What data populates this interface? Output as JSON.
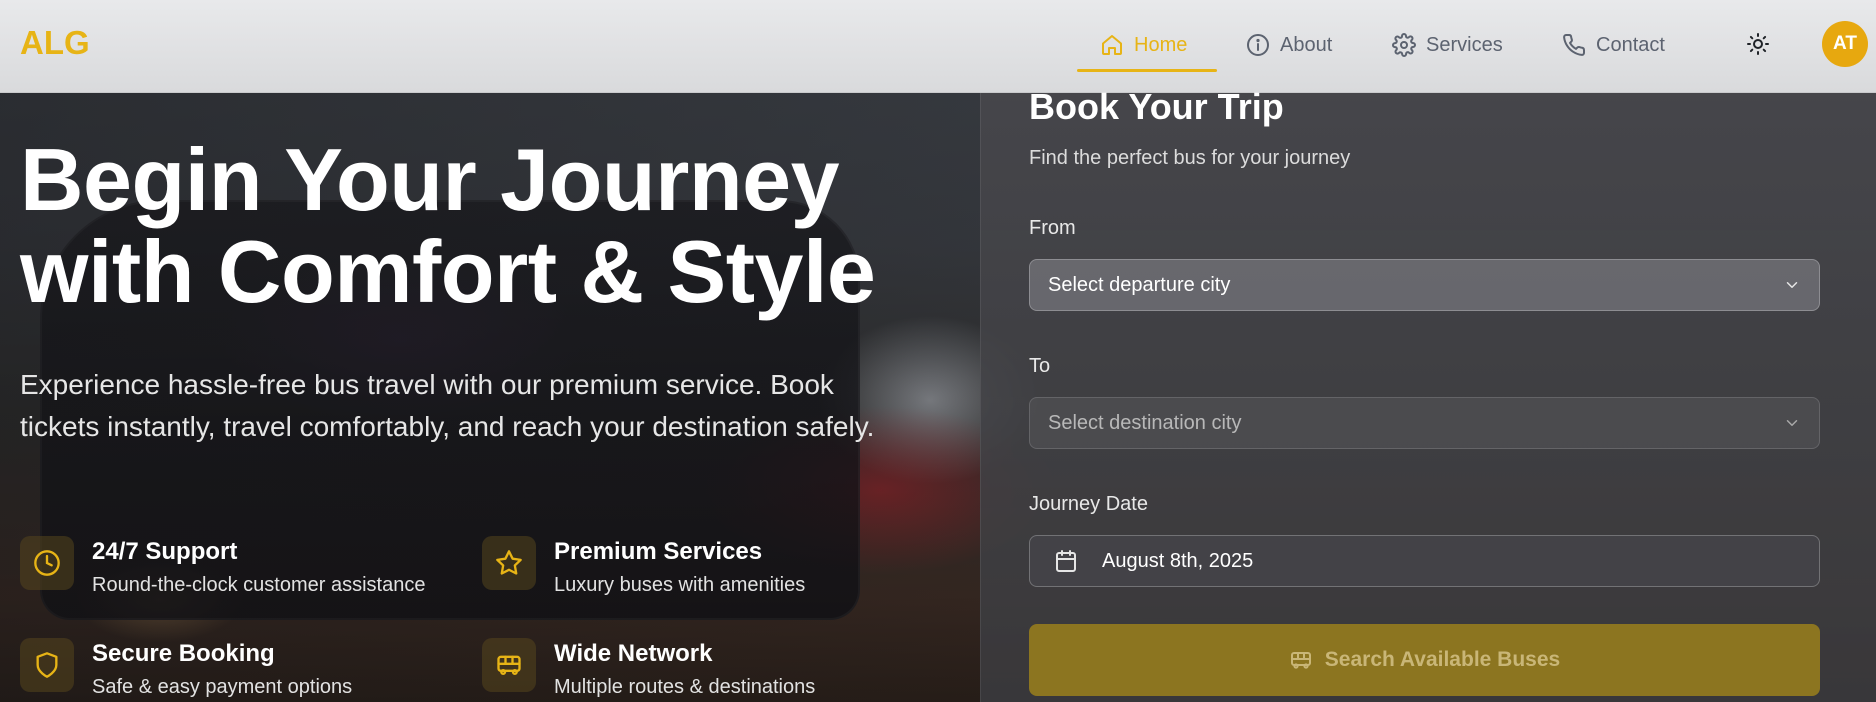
{
  "header": {
    "logo": "ALG",
    "nav": [
      {
        "label": "Home",
        "icon": "home-icon",
        "active": true
      },
      {
        "label": "About",
        "icon": "info-icon"
      },
      {
        "label": "Services",
        "icon": "gear-icon"
      },
      {
        "label": "Contact",
        "icon": "phone-icon"
      }
    ],
    "theme_icon": "sun-icon",
    "avatar_initials": "AT"
  },
  "hero": {
    "title": "Begin Your Journey with Comfort & Style",
    "subtitle": "Experience hassle-free bus travel with our premium service. Book tickets instantly, travel comfortably, and reach your destination safely.",
    "features": [
      {
        "icon": "clock-icon",
        "title": "24/7 Support",
        "desc": "Round-the-clock customer assistance"
      },
      {
        "icon": "star-icon",
        "title": "Premium Services",
        "desc": "Luxury buses with amenities"
      },
      {
        "icon": "shield-icon",
        "title": "Secure Booking",
        "desc": "Safe & easy payment options"
      },
      {
        "icon": "bus-icon",
        "title": "Wide Network",
        "desc": "Multiple routes & destinations"
      }
    ]
  },
  "booking": {
    "title": "Book Your Trip",
    "subtitle": "Find the perfect bus for your journey",
    "from_label": "From",
    "from_value": "Select departure city",
    "to_label": "To",
    "to_value": "Select destination city",
    "date_label": "Journey Date",
    "date_value": "August 8th, 2025",
    "search_button": "Search Available Buses"
  },
  "colors": {
    "accent": "#e7b416",
    "nav_text": "#5c6370",
    "header_bg": "#e2e3e5"
  }
}
